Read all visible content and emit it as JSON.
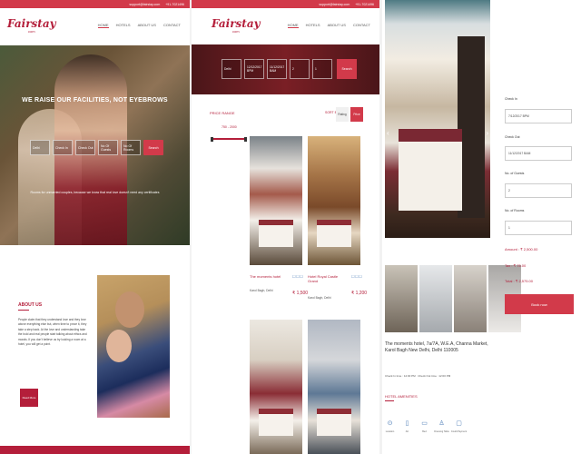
{
  "topbar": {
    "email": "support@fairstay.com",
    "phone": "+91-7021496"
  },
  "logo": {
    "main": "Fairstay",
    "sub": "com"
  },
  "menu": [
    "HOME",
    "HOTELS",
    "ABOUT US",
    "CONTACT"
  ],
  "hero": {
    "title": "WE RAISE OUR FACILITIES, NOT EYEBROWS",
    "fields": [
      "Delhi",
      "Check In",
      "Check Out",
      "No Of Guests",
      "No Of Rooms"
    ],
    "search_label": "Search",
    "subtitle": "Rooms for unmarried couples, because we know that real love doesn't need any certificates"
  },
  "about": {
    "title": "ABOUT US",
    "text": "People claim that they understand love and they love above everything else but, when time to prove it, they take a step back. At the love and understanding take the bold and real people start talking about ethics and morals. If you don't believe us try looking a room at a hotel, you will get a point.",
    "read_more": "Read More"
  },
  "listing": {
    "fields": [
      "Delhi",
      "12/12/2017 BPM",
      "11/12/2017 BAM",
      "2",
      "1"
    ],
    "search_label": "Search",
    "price_range_title": "PRICE RANGE",
    "price_range_values": "750 - 2000",
    "sort_by": "SORT BY",
    "sort_rating": "Rating",
    "sort_price": "Price",
    "cards": [
      {
        "name": "The moments hotel",
        "location": "Karol Bagh, Delhi",
        "price": "₹ 1,500",
        "icons": "☐☐☐"
      },
      {
        "name": "Hotel Royal Castle Grand",
        "location": "Karol Bagh, Delhi",
        "price": "₹ 1,200",
        "icons": "☐☐☐"
      },
      {
        "name": "",
        "location": "",
        "price": "",
        "icons": ""
      },
      {
        "name": "",
        "location": "",
        "price": "",
        "icons": ""
      }
    ]
  },
  "detail": {
    "address": "The moments hotel, 7a/7A, W.E.A, Channa Market, Karol Bagh New Delhi, Delhi 110005",
    "checkin": "Check In time : 12:00 PM",
    "checkout": "Check Out time : 12:00 PM",
    "amenities_title": "HOTEL AMENITIES",
    "amenities": [
      {
        "label": "Location",
        "icon": "map-pin-icon",
        "glyph": "⊙"
      },
      {
        "label": "AC",
        "icon": "ac-icon",
        "glyph": "▯"
      },
      {
        "label": "Bed",
        "icon": "bed-icon",
        "glyph": "▭"
      },
      {
        "label": "Dressing Table",
        "icon": "dresser-icon",
        "glyph": "♙"
      },
      {
        "label": "Credit Payment",
        "icon": "card-icon",
        "glyph": "▢"
      }
    ]
  },
  "booking": {
    "checkin_label": "Check In",
    "checkin_value": "7/12/2017 BPM",
    "checkout_label": "Check Out",
    "checkout_value": "11/12/2017 BAM",
    "guests_label": "No. of Guests",
    "guests_value": "2",
    "rooms_label": "No. of Rooms",
    "rooms_value": "1",
    "amount": "Amount : ₹ 2,500.00",
    "tax": "Tax : ₹ 75.00",
    "total": "Total : ₹ 2,575.00",
    "book_now": "Book now"
  },
  "colors": {
    "brand": "#d23a4a",
    "brand_dark": "#b41e3a"
  }
}
